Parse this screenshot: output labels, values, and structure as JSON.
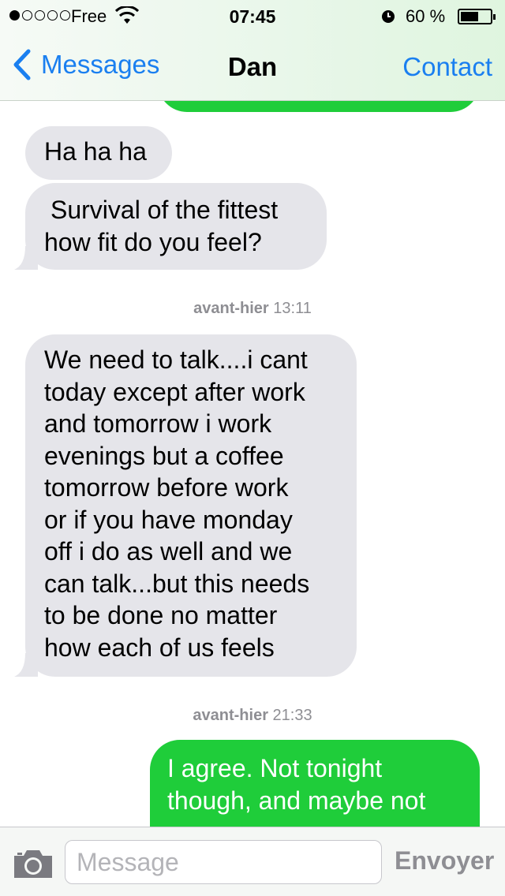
{
  "status_bar": {
    "signal_bars_filled": 1,
    "signal_bars_total": 5,
    "carrier": "Free",
    "time": "07:45",
    "battery_percent": "60 %",
    "battery_level": 0.6,
    "icons": [
      "wifi-icon",
      "alarm-icon",
      "battery-icon"
    ]
  },
  "nav": {
    "back_label": "Messages",
    "title": "Dan",
    "right_label": "Contact"
  },
  "thread": {
    "messages": [
      {
        "from": "contact",
        "text": "Ha ha ha"
      },
      {
        "from": "contact",
        "lines": [
          "Survival of the fittest",
          "how fit do you feel?"
        ]
      },
      {
        "timestamp_day": "avant-hier",
        "timestamp_time": "13:11"
      },
      {
        "from": "contact",
        "lines": [
          "We need to talk....i cant",
          "today except after work",
          "and tomorrow i work",
          "evenings but a coffee",
          "tomorrow before work",
          "or if you have monday",
          "off i do as well and we",
          "can talk...but this needs",
          "to be done no matter",
          "how each of us feels"
        ]
      },
      {
        "timestamp_day": "avant-hier",
        "timestamp_time": "21:33"
      },
      {
        "from": "me",
        "lines": [
          "I agree.  Not tonight",
          "though, and maybe not"
        ]
      }
    ]
  },
  "input_bar": {
    "placeholder": "Message",
    "send_label": "Envoyer",
    "icons": [
      "camera-icon"
    ]
  },
  "colors": {
    "accent": "#1a7ff0",
    "incoming_bubble": "#e5e5ea",
    "outgoing_bubble": "#1fcd3a",
    "timestamp": "#8e8e93"
  }
}
